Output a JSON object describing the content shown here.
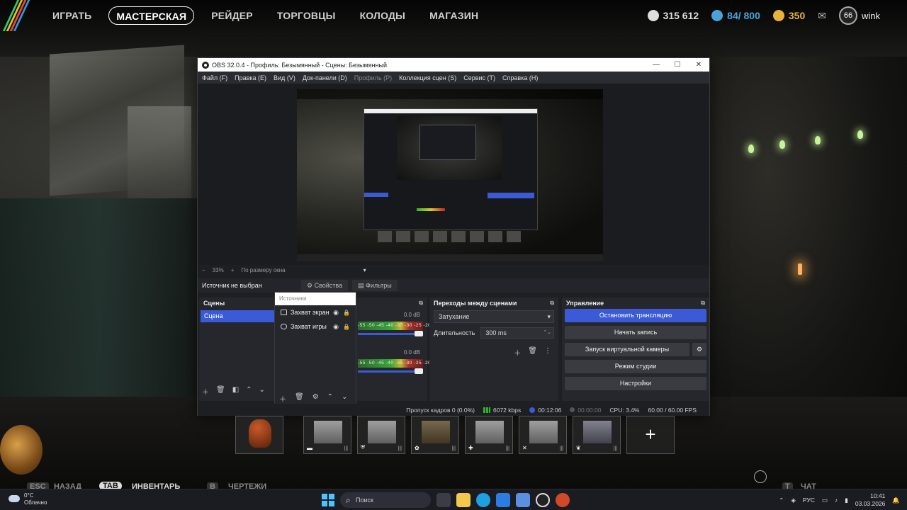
{
  "game": {
    "nav": [
      "ИГРАТЬ",
      "МАСТЕРСКАЯ",
      "РЕЙДЕР",
      "ТОРГОВЦЫ",
      "КОЛОДЫ",
      "МАГАЗИН"
    ],
    "active_nav": "МАСТЕРСКАЯ",
    "currency_primary": "315 612",
    "currency_secondary": "84/ 800",
    "currency_tertiary": "350",
    "level": "66",
    "username": "wink",
    "bottom_hints": [
      "НАЗАД",
      "ИНВЕНТАРЬ",
      "ЧЕРТЕЖИ",
      "ЧАТ"
    ],
    "bottom_keys": [
      "ESC",
      "TAB",
      "B",
      "T"
    ]
  },
  "obs": {
    "title": "OBS 32.0.4 - Профиль: Безымянный - Сцены: Безымянный",
    "menu": [
      "Файл (F)",
      "Правка (E)",
      "Вид (V)",
      "Док-панели (D)",
      "Профиль (P)",
      "Коллекция сцен (S)",
      "Сервис (T)",
      "Справка (H)"
    ],
    "zoom": {
      "minus": "−",
      "value": "33%",
      "plus": "+",
      "fit": "По размеру окна"
    },
    "source_bar": {
      "no_source": "Источник не выбран",
      "properties": "Свойства",
      "filters": "Фильтры"
    },
    "scenes": {
      "header": "Сцены",
      "items": [
        "Сцена"
      ]
    },
    "sources": {
      "header": "Источники",
      "items": [
        {
          "label": "Захват экран"
        },
        {
          "label": "Захват игры"
        }
      ]
    },
    "mixer": {
      "tracks": [
        {
          "db": "0.0 dB"
        },
        {
          "db": "0.0 dB"
        }
      ],
      "ticks": "-55 -50 -45 -40 -35 -30 -25 -20 -15 -10 -5 0"
    },
    "transitions": {
      "header": "Переходы между сценами",
      "type": "Затухание",
      "duration_label": "Длительность",
      "duration_value": "300 ms"
    },
    "controls": {
      "header": "Управление",
      "stop_stream": "Остановить трансляцию",
      "start_record": "Начать запись",
      "virtual_cam": "Запуск виртуальной камеры",
      "studio_mode": "Режим студии",
      "settings": "Настройки"
    },
    "status": {
      "dropped": "Пропуск кадров 0 (0.0%)",
      "bitrate": "6072 kbps",
      "live_time": "00:12:06",
      "rec_time": "00:00:00",
      "cpu": "CPU: 3.4%",
      "fps": "60.00 / 60.00 FPS"
    }
  },
  "taskbar": {
    "weather_temp": "0°C",
    "weather_desc": "Облачно",
    "search": "Поиск",
    "lang": "РУС",
    "time": "10:41",
    "date": "03.03.2026"
  },
  "colors": {
    "accent": "#3b5bd6",
    "obs_bg": "#1e1f23",
    "gold": "#e8b23a",
    "blue_currency": "#4aa3d8"
  }
}
